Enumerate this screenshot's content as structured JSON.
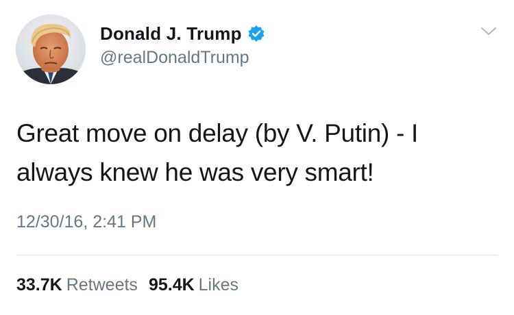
{
  "tweet": {
    "author": {
      "display_name": "Donald J. Trump",
      "handle": "@realDonaldTrump",
      "verified": true
    },
    "text_lines": [
      "Great move on delay (by V. Putin) - I",
      "always knew he was very smart!"
    ],
    "timestamp": "12/30/16, 2:41 PM",
    "stats": {
      "retweets_count": "33.7K",
      "retweets_label": "Retweets",
      "likes_count": "95.4K",
      "likes_label": "Likes"
    }
  },
  "icons": {
    "verified": "verified-badge-icon",
    "menu": "chevron-down-icon"
  },
  "colors": {
    "text_primary": "#14171a",
    "text_secondary": "#657786",
    "verified_blue": "#1da1f2",
    "divider": "#e1e8ed"
  }
}
